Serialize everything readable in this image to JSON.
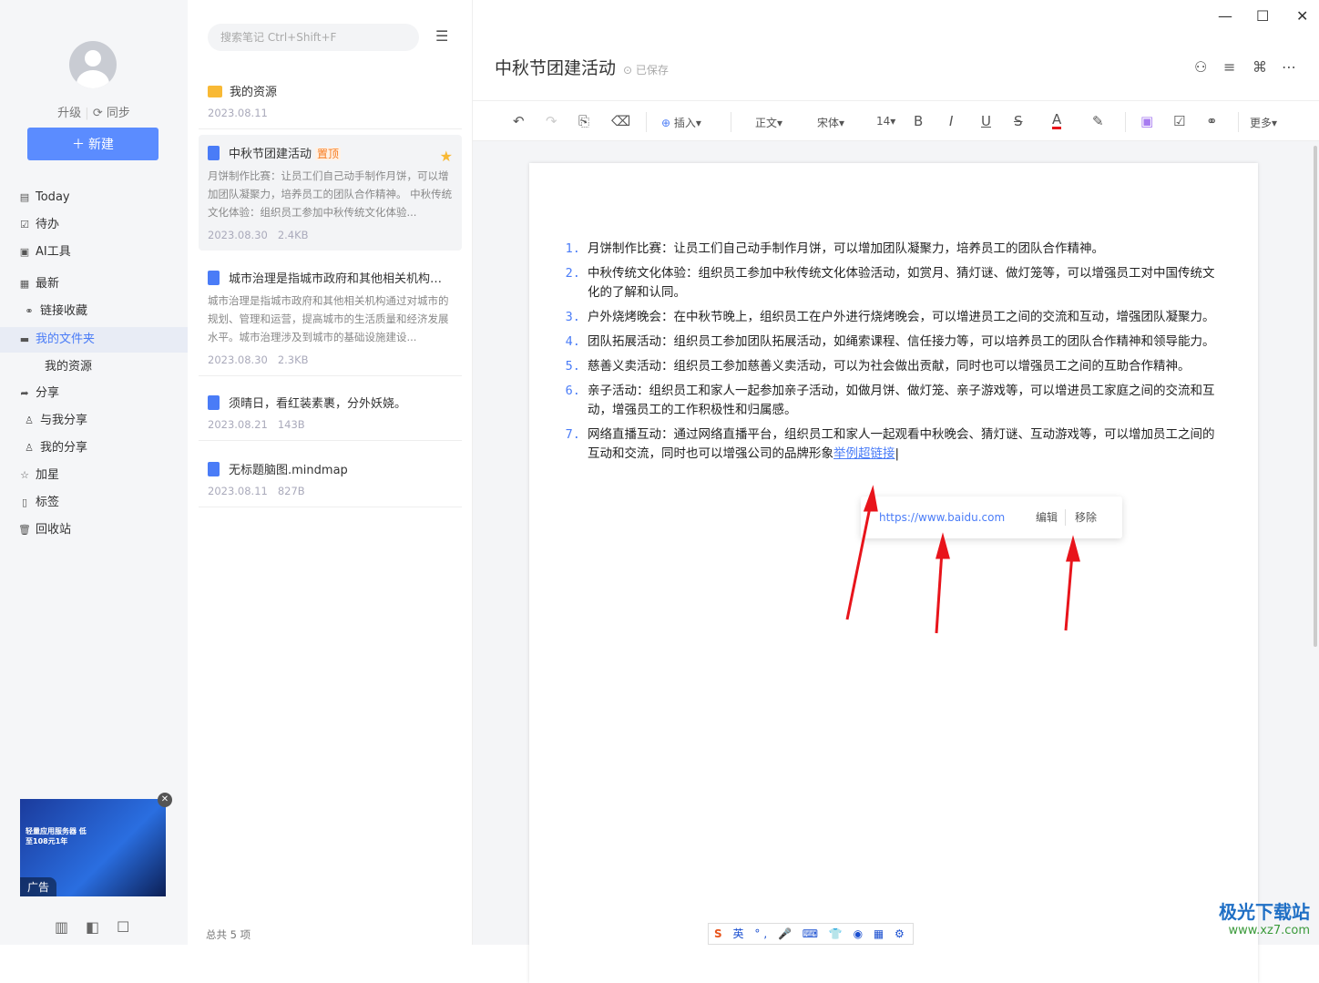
{
  "sidebar": {
    "upgrade": "升级",
    "sync": "同步",
    "new_label": "新建",
    "items": [
      {
        "label": "Today",
        "icon": "calendar-icon"
      },
      {
        "label": "待办",
        "icon": "checkbox-icon"
      },
      {
        "label": "AI工具",
        "icon": "ai-icon"
      },
      {
        "label": "最新",
        "icon": "grid-icon"
      },
      {
        "label": "链接收藏",
        "icon": "link-icon"
      },
      {
        "label": "我的文件夹",
        "icon": "folder-icon"
      },
      {
        "label": "我的资源",
        "icon": ""
      },
      {
        "label": "分享",
        "icon": "share-icon"
      },
      {
        "label": "与我分享",
        "icon": "user-icon"
      },
      {
        "label": "我的分享",
        "icon": "user-icon"
      },
      {
        "label": "加星",
        "icon": "star-icon"
      },
      {
        "label": "标签",
        "icon": "tag-icon"
      },
      {
        "label": "回收站",
        "icon": "trash-icon"
      }
    ],
    "ad": {
      "tag": "广告",
      "text": "轻量应用服务器 低至108元1年"
    }
  },
  "list": {
    "search_placeholder": "搜索笔记 Ctrl+Shift+F",
    "total": "总共 5 项",
    "items": [
      {
        "title": "我的资源",
        "date": "2023.08.11"
      },
      {
        "title": "中秋节团建活动",
        "badge": "置顶",
        "summary": "月饼制作比赛：让员工们自己动手制作月饼，可以增加团队凝聚力，培养员工的团队合作精神。 中秋传统文化体验：组织员工参加中秋传统文化体验...",
        "date": "2023.08.30",
        "size": "2.4KB"
      },
      {
        "title": "城市治理是指城市政府和其他相关机构通...",
        "summary": "城市治理是指城市政府和其他相关机构通过对城市的规划、管理和运营，提高城市的生活质量和经济发展水平。城市治理涉及到城市的基础设施建设...",
        "date": "2023.08.30",
        "size": "2.3KB"
      },
      {
        "title": "须晴日，看红装素裹，分外妖娆。",
        "date": "2023.08.21",
        "size": "143B"
      },
      {
        "title": "无标题脑图.mindmap",
        "date": "2023.08.11",
        "size": "827B"
      }
    ]
  },
  "doc": {
    "title": "中秋节团建活动",
    "saved": "已保存",
    "toolbar": {
      "insert": "插入",
      "style": "正文",
      "font": "宋体",
      "size": "14",
      "more": "更多"
    },
    "items": [
      "月饼制作比赛：让员工们自己动手制作月饼，可以增加团队凝聚力，培养员工的团队合作精神。",
      "中秋传统文化体验：组织员工参加中秋传统文化体验活动，如赏月、猜灯谜、做灯笼等，可以增强员工对中国传统文化的了解和认同。",
      "户外烧烤晚会：在中秋节晚上，组织员工在户外进行烧烤晚会，可以增进员工之间的交流和互动，增强团队凝聚力。",
      "团队拓展活动：组织员工参加团队拓展活动，如绳索课程、信任接力等，可以培养员工的团队合作精神和领导能力。",
      "慈善义卖活动：组织员工参加慈善义卖活动，可以为社会做出贡献，同时也可以增强员工之间的互助合作精神。",
      "亲子活动：组织员工和家人一起参加亲子活动，如做月饼、做灯笼、亲子游戏等，可以增进员工家庭之间的交流和互动，增强员工的工作积极性和归属感。",
      "网络直播互动：通过网络直播平台，组织员工和家人一起观看中秋晚会、猜灯谜、互动游戏等，可以增加员工之间的互动和交流，同时也可以增强公司的品牌形象"
    ],
    "link_text": "举例超链接",
    "link_popup": {
      "url": "https://www.baidu.com",
      "edit": "编辑",
      "remove": "移除"
    }
  },
  "ime": {
    "lang": "英"
  },
  "watermark": {
    "name": "极光下载站",
    "url": "www.xz7.com"
  },
  "colors": {
    "accent": "#5b8cff",
    "annotation": "#e8141b"
  }
}
